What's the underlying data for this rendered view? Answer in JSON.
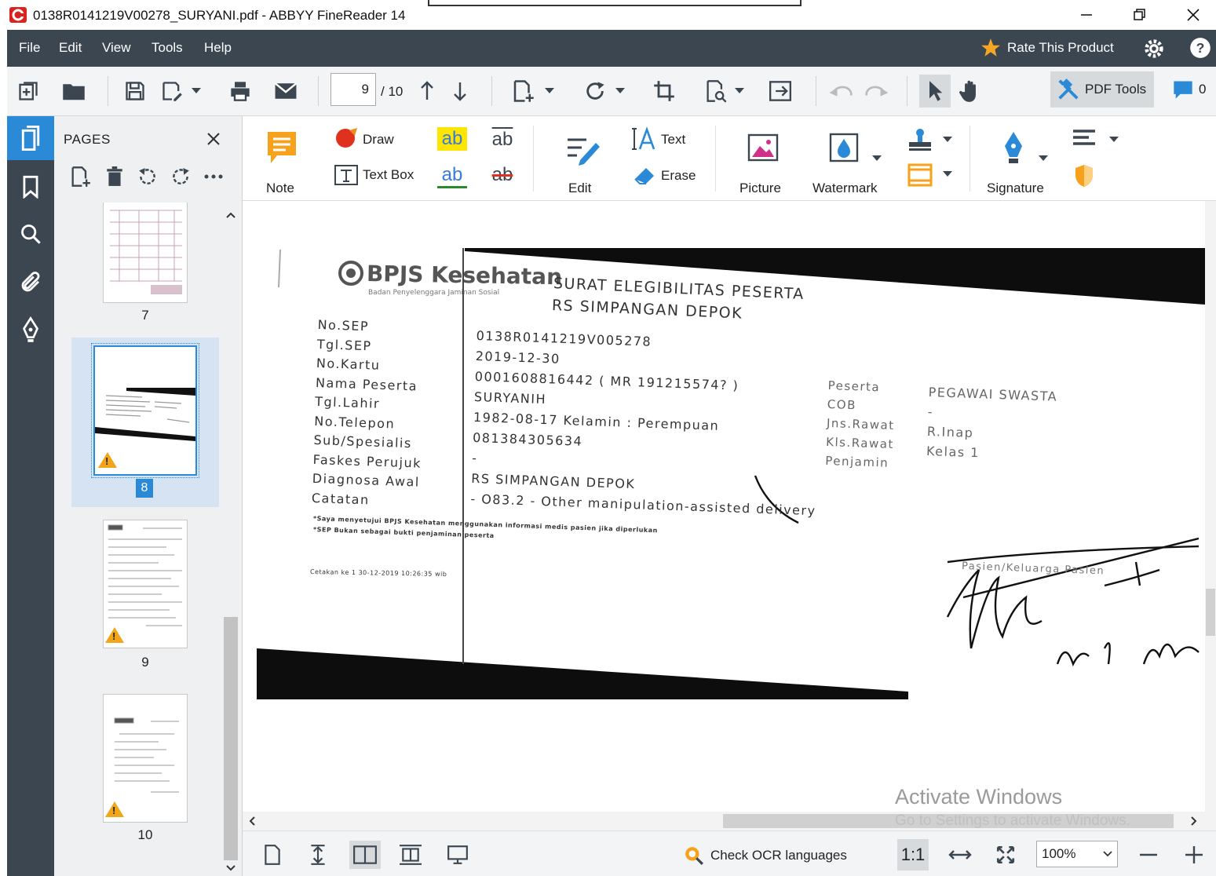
{
  "window": {
    "title": "0138R0141219V00278_SURYANI.pdf - ABBYY FineReader 14"
  },
  "menu": {
    "items": [
      "File",
      "Edit",
      "View",
      "Tools",
      "Help"
    ],
    "rate_label": "Rate This Product"
  },
  "toolbar": {
    "current_page": "9",
    "page_total": "/ 10",
    "pdf_tools_label": "PDF Tools",
    "comments_count": "0"
  },
  "pages_panel": {
    "header": "PAGES",
    "thumbnails": [
      {
        "label": "7",
        "warning": false,
        "selected": false
      },
      {
        "label": "8",
        "warning": true,
        "selected": true
      },
      {
        "label": "9",
        "warning": true,
        "selected": false
      },
      {
        "label": "10",
        "warning": true,
        "selected": false
      }
    ]
  },
  "ribbon": {
    "note": "Note",
    "draw": "Draw",
    "text_box": "Text Box",
    "edit": "Edit",
    "text": "Text",
    "erase": "Erase",
    "picture": "Picture",
    "watermark": "Watermark",
    "signature": "Signature",
    "ab": "ab"
  },
  "document": {
    "logo_text": "BPJS Kesehatan",
    "logo_sub": "Badan Penyelenggara Jaminan Sosial",
    "heading1": "SURAT ELEGIBILITAS PESERTA",
    "heading2": "RS SIMPANGAN DEPOK",
    "fields": [
      {
        "label": "No.SEP",
        "value": "0138R0141219V005278"
      },
      {
        "label": "Tgl.SEP",
        "value": "2019-12-30"
      },
      {
        "label": "No.Kartu",
        "value": "0001608816442 ( MR  191215574? )"
      },
      {
        "label": "Nama Peserta",
        "value": "SURYANIH"
      },
      {
        "label": "Tgl.Lahir",
        "value": "1982-08-17   Kelamin : Perempuan"
      },
      {
        "label": "No.Telepon",
        "value": "081384305634"
      },
      {
        "label": "Sub/Spesialis",
        "value": "-"
      },
      {
        "label": "Faskes Perujuk",
        "value": "RS SIMPANGAN DEPOK"
      },
      {
        "label": "Diagnosa Awal",
        "value": "- O83.2 - Other manipulation-assisted delivery"
      },
      {
        "label": "Catatan",
        "value": ""
      }
    ],
    "right_labels": [
      "Peserta",
      "COB",
      "Jns.Rawat",
      "Kls.Rawat",
      "Penjamin"
    ],
    "right_values": [
      "PEGAWAI SWASTA",
      "-",
      "R.Inap",
      "Kelas 1",
      ""
    ],
    "note1": "*Saya menyetujui BPJS Kesehatan menggunakan informasi medis pasien jika diperlukan",
    "note2": "*SEP Bukan sebagai bukti penjaminan peserta",
    "printed": "Cetakan ke 1 30-12-2019 10:26:35 wib",
    "signer_label": "Pasien/Keluarga Pasien"
  },
  "statusbar": {
    "ocr_label": "Check OCR languages",
    "ratio": "1:1",
    "zoom": "100%"
  },
  "activation": {
    "line1": "Activate Windows",
    "line2": "Go to Settings to activate Windows."
  },
  "colors": {
    "menubar": "#3c4650",
    "accent": "#2b8ad8",
    "note": "#f7a21c",
    "draw": "#e0301e",
    "warn": "#f2a51a"
  }
}
